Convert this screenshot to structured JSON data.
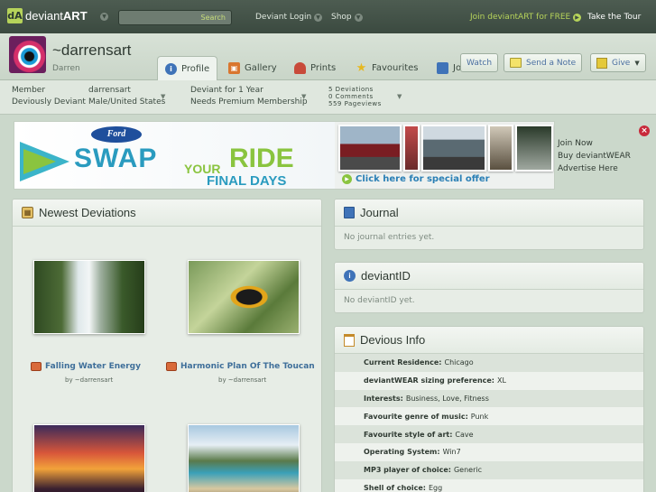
{
  "topbar": {
    "logo_text_light": "deviant",
    "logo_text_bold": "ART",
    "search_placeholder": "",
    "search_button": "Search",
    "login": "Deviant Login",
    "shop": "Shop",
    "join": "Join deviantART for FREE",
    "tour": "Take the Tour"
  },
  "profile": {
    "username": "~darrensart",
    "real_name": "Darren",
    "tabs": [
      {
        "label": "Profile",
        "icon": "info-icon",
        "active": true
      },
      {
        "label": "Gallery",
        "icon": "gallery-icon"
      },
      {
        "label": "Prints",
        "icon": "prints-icon"
      },
      {
        "label": "Favourites",
        "icon": "star-icon"
      },
      {
        "label": "Journal",
        "icon": "journal-icon"
      }
    ],
    "buttons": {
      "watch": "Watch",
      "send_note": "Send a Note",
      "give": "Give"
    }
  },
  "stats": {
    "member_line1": "Member",
    "member_line2": "Deviously Deviant",
    "user_line1": "darrensart",
    "user_line2": "Male/United States",
    "deviant_line1": "Deviant for 1 Year",
    "deviant_line2": "Needs Premium Membership",
    "deviations": "5 Deviations",
    "comments": "0 Comments",
    "pageviews": "559 Pageviews"
  },
  "ad": {
    "brand": "Ford",
    "swap": "SWAP",
    "your": "YOUR",
    "ride": "RIDE",
    "final_days": "FINAL DAYS",
    "cta": "Click here for special offer",
    "links": [
      "Join Now",
      "Buy deviantWEAR",
      "Advertise Here"
    ]
  },
  "newest_deviations": {
    "title": "Newest Deviations",
    "items": [
      {
        "title": "Falling Water Energy",
        "by": "by ~darrensart"
      },
      {
        "title": "Harmonic Plan Of The Toucan",
        "by": "by ~darrensart"
      }
    ]
  },
  "journal": {
    "title": "Journal",
    "empty": "No journal entries yet."
  },
  "deviantid": {
    "title": "deviantID",
    "empty": "No deviantID yet."
  },
  "devious_info": {
    "title": "Devious Info",
    "rows": [
      {
        "label": "Current Residence:",
        "value": "Chicago"
      },
      {
        "label": "deviantWEAR sizing preference:",
        "value": "XL"
      },
      {
        "label": "Interests:",
        "value": "Business, Love, Fitness"
      },
      {
        "label": "Favourite genre of music:",
        "value": "Punk"
      },
      {
        "label": "Favourite style of art:",
        "value": "Cave"
      },
      {
        "label": "Operating System:",
        "value": "Win7"
      },
      {
        "label": "MP3 player of choice:",
        "value": "Generic"
      },
      {
        "label": "Shell of choice:",
        "value": "Egg"
      }
    ]
  },
  "colors": {
    "topbar": "#3b4a40",
    "accent_green": "#b6d35a",
    "link_blue": "#3f6f9a",
    "page_bg": "#cbd8cb"
  }
}
